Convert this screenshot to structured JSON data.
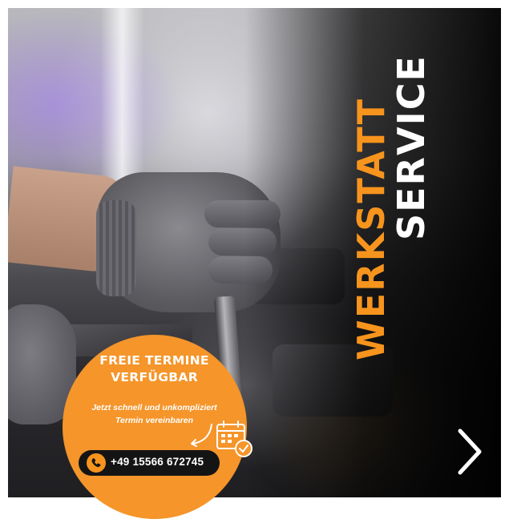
{
  "headline": {
    "word1": "WERKSTATT",
    "word2": "SERVICE"
  },
  "callout": {
    "title_line1": "FREIE TERMINE",
    "title_line2": "VERFÜGBAR",
    "subtitle_line1": "Jetzt schnell und unkompliziert",
    "subtitle_line2": "Termin vereinbaren",
    "phone": "+49 15566 672745"
  },
  "icons": {
    "phone": "phone-icon",
    "calendar": "calendar-check-icon",
    "arrow": "curved-arrow-icon",
    "next": "chevron-right-icon"
  },
  "colors": {
    "accent": "#f7941d",
    "badge": "#f5952a",
    "pill": "#141414",
    "text_light": "#ffffff"
  }
}
